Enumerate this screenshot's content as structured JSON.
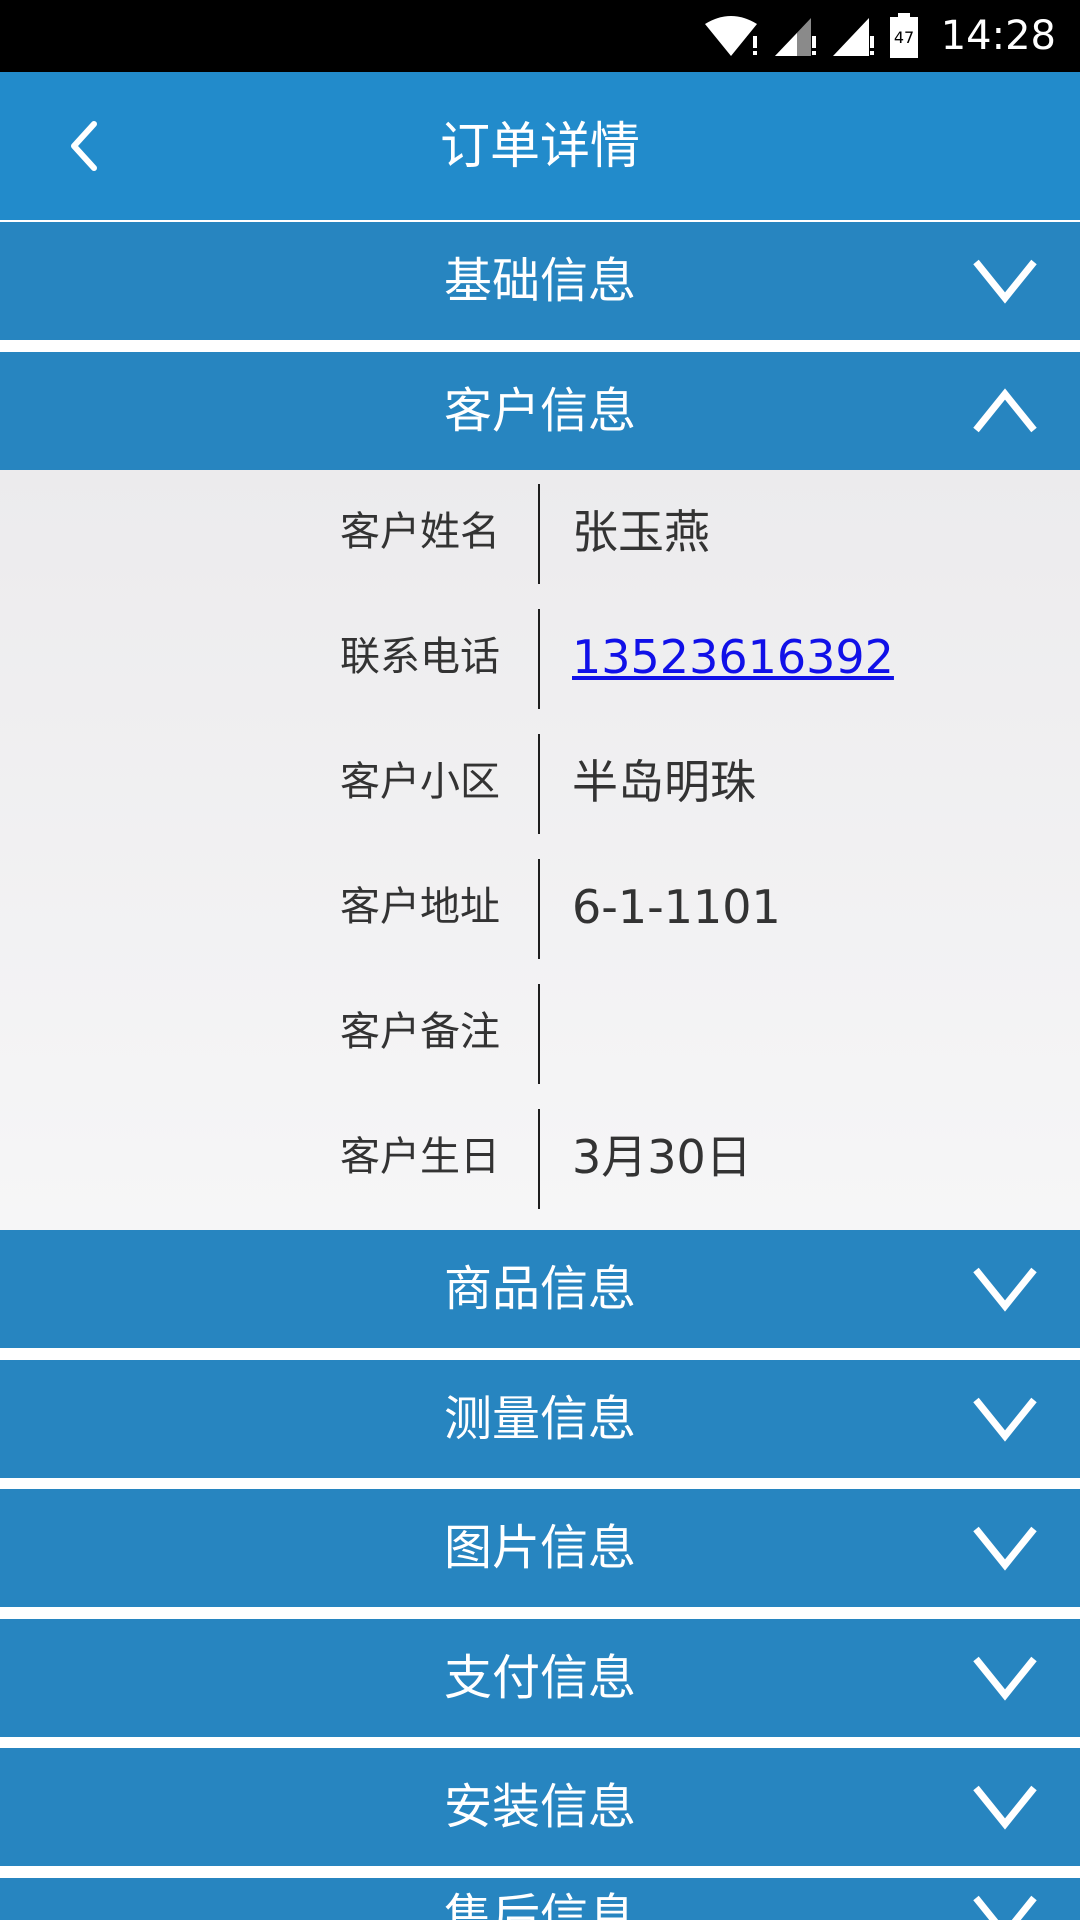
{
  "status_bar": {
    "time": "14:28",
    "battery_level": "47",
    "icons": [
      "wifi-icon",
      "signal-icon",
      "signal-icon",
      "battery-icon"
    ]
  },
  "header": {
    "title": "订单详情",
    "back_icon": "back-arrow-icon"
  },
  "sections": {
    "basic": {
      "label": "基础信息",
      "expanded": false
    },
    "customer": {
      "label": "客户信息",
      "expanded": true
    },
    "product": {
      "label": "商品信息",
      "expanded": false
    },
    "measure": {
      "label": "测量信息",
      "expanded": false
    },
    "image": {
      "label": "图片信息",
      "expanded": false
    },
    "payment": {
      "label": "支付信息",
      "expanded": false
    },
    "install": {
      "label": "安装信息",
      "expanded": false
    },
    "aftersale": {
      "label": "售后信息",
      "expanded": false
    }
  },
  "customer_info": {
    "rows": [
      {
        "label": "客户姓名",
        "value": "张玉燕"
      },
      {
        "label": "联系电话",
        "value": "13523616392"
      },
      {
        "label": "客户小区",
        "value": "半岛明珠"
      },
      {
        "label": "客户地址",
        "value": "6-1-1101"
      },
      {
        "label": "客户备注",
        "value": ""
      },
      {
        "label": "客户生日",
        "value": "3月30日"
      }
    ]
  },
  "colors": {
    "header_bg": "#228bcb",
    "section_bg": "#2785c0",
    "link": "#1010e8"
  }
}
